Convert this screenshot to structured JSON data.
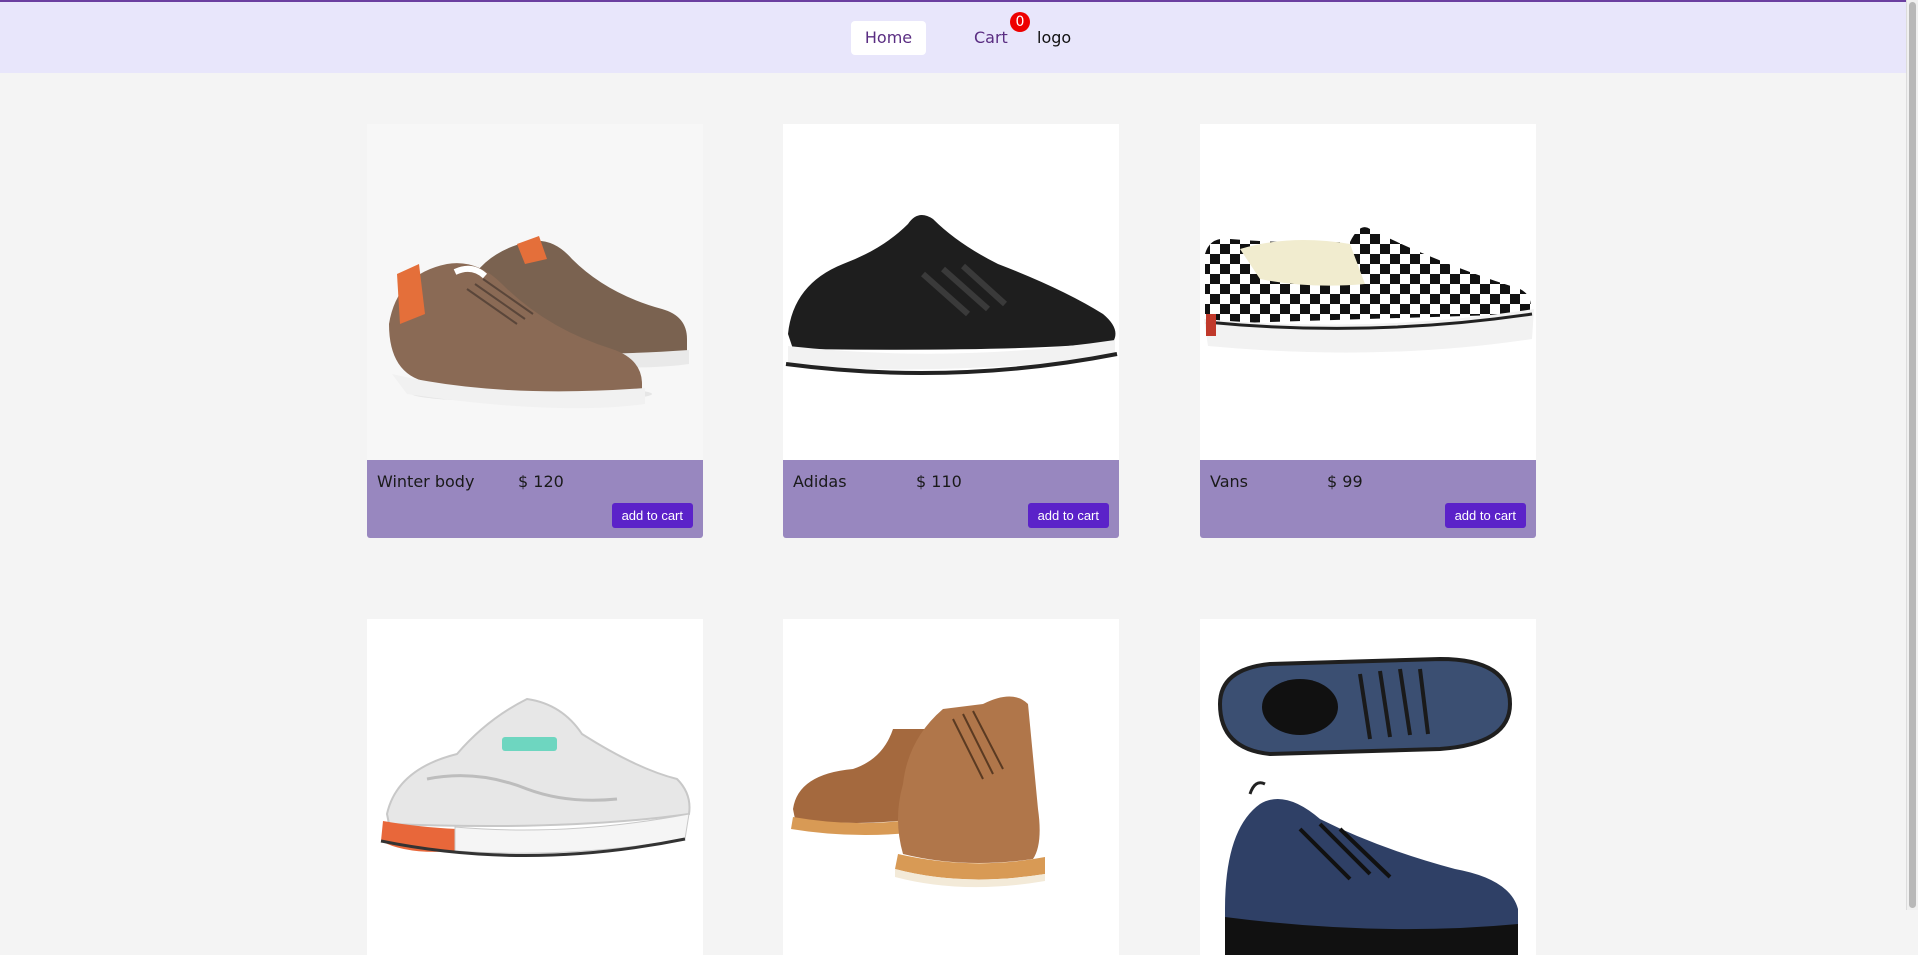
{
  "nav": {
    "home_label": "Home",
    "cart_label": "Cart",
    "cart_count": "0",
    "logo_text": "logo"
  },
  "products": [
    {
      "name": "Winter body",
      "price": "$ 120",
      "button": "add to cart",
      "image": "brown-suede-sneakers"
    },
    {
      "name": "Adidas",
      "price": "$ 110",
      "button": "add to cart",
      "image": "black-running-shoe"
    },
    {
      "name": "Vans",
      "price": "$ 99",
      "button": "add to cart",
      "image": "checkered-slip-on"
    },
    {
      "image": "white-chunky-sneaker"
    },
    {
      "image": "brown-leather-boots"
    },
    {
      "image": "blue-knit-shoes"
    }
  ],
  "colors": {
    "nav_bg": "#e8e6fb",
    "accent": "#5a2d82",
    "card_info_bg": "#9887bf",
    "button_bg": "#5b22c9",
    "badge_bg": "#ee0000"
  }
}
